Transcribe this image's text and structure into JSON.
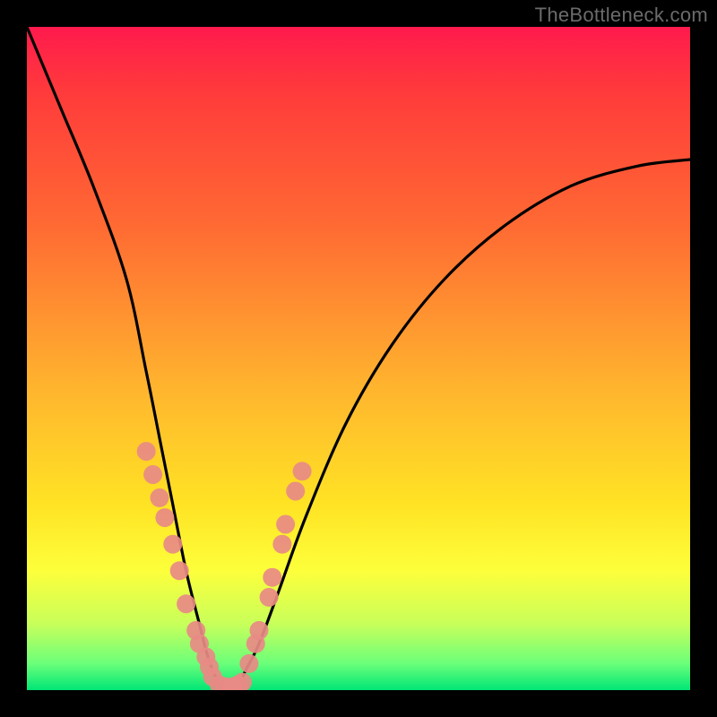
{
  "watermark": "TheBottleneck.com",
  "chart_data": {
    "type": "line",
    "title": "",
    "xlabel": "",
    "ylabel": "",
    "xlim": [
      0,
      100
    ],
    "ylim": [
      0,
      100
    ],
    "grid": false,
    "legend": false,
    "series": [
      {
        "name": "bottleneck-curve",
        "x": [
          0,
          5,
          10,
          15,
          18,
          20,
          22,
          24,
          26,
          27,
          28,
          29,
          30,
          31,
          32,
          33,
          35,
          38,
          42,
          48,
          55,
          63,
          72,
          82,
          92,
          100
        ],
        "y": [
          100,
          88,
          76,
          62,
          48,
          38,
          28,
          18,
          10,
          6,
          3,
          1,
          0,
          0,
          1,
          3,
          7,
          15,
          26,
          40,
          52,
          62,
          70,
          76,
          79,
          80
        ]
      }
    ],
    "scatter": [
      {
        "name": "markers-left",
        "color": "#e88a85",
        "x": [
          18.0,
          19.0,
          20.0,
          20.8,
          22.0,
          23.0,
          24.0,
          25.5,
          26.0,
          27.0,
          27.5,
          28.0
        ],
        "y": [
          36.0,
          32.5,
          29.0,
          26.0,
          22.0,
          18.0,
          13.0,
          9.0,
          7.0,
          5.0,
          3.5,
          2.0
        ]
      },
      {
        "name": "markers-bottom",
        "color": "#e88a85",
        "x": [
          29.0,
          30.0,
          31.0,
          31.8,
          32.5
        ],
        "y": [
          0.8,
          0.5,
          0.5,
          0.8,
          1.2
        ]
      },
      {
        "name": "markers-right",
        "color": "#e88a85",
        "x": [
          33.5,
          34.5,
          35.0,
          36.5,
          37.0,
          38.5,
          39.0,
          40.5,
          41.5
        ],
        "y": [
          4.0,
          7.0,
          9.0,
          14.0,
          17.0,
          22.0,
          25.0,
          30.0,
          33.0
        ]
      }
    ]
  }
}
